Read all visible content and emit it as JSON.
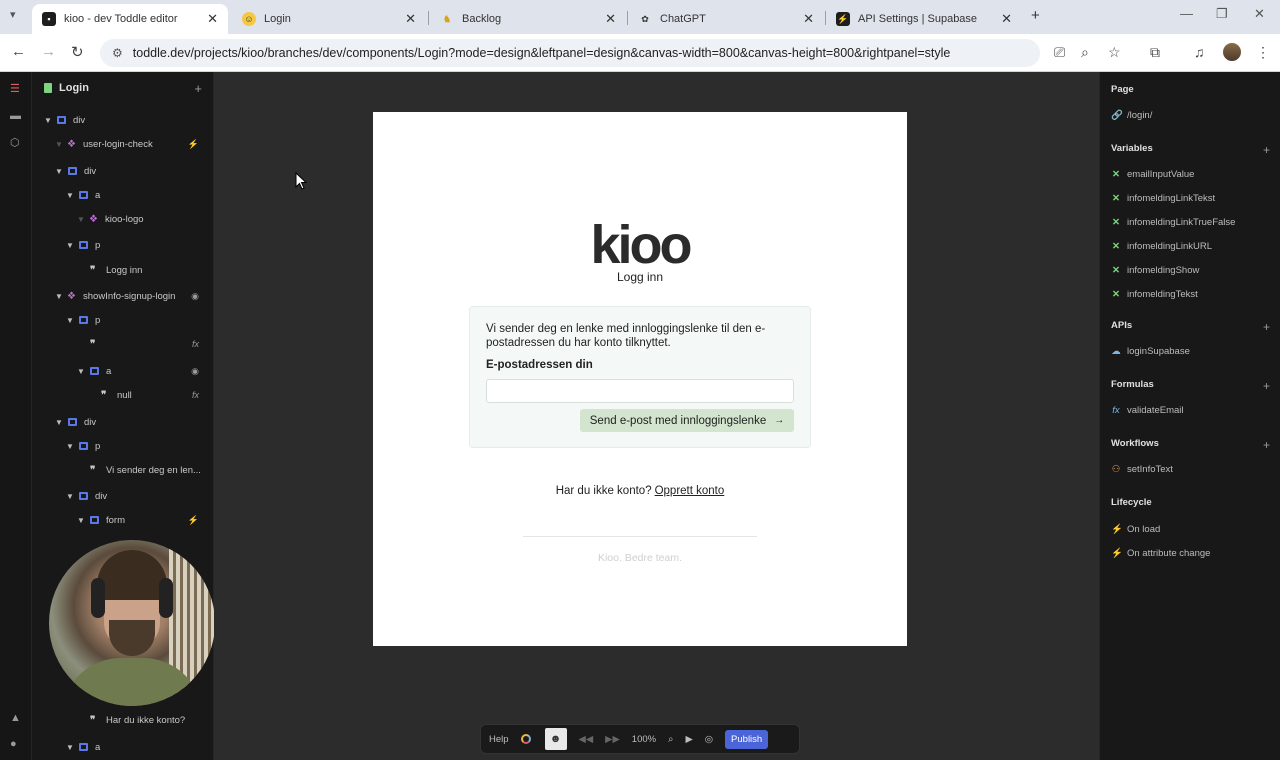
{
  "browser": {
    "tabs": [
      {
        "title": "kioo - dev Toddle editor",
        "icon": "toddle-icon",
        "active": true
      },
      {
        "title": "Login",
        "icon": "smiley-icon",
        "active": false
      },
      {
        "title": "Backlog",
        "icon": "backlog-icon",
        "active": false
      },
      {
        "title": "ChatGPT",
        "icon": "chatgpt-icon",
        "active": false
      },
      {
        "title": "API Settings | Supabase",
        "icon": "supabase-icon",
        "active": false
      }
    ],
    "url": "toddle.dev/projects/kioo/branches/dev/components/Login?mode=design&leftpanel=design&canvas-width=800&canvas-height=800&rightpanel=style"
  },
  "left_panel": {
    "title": "Login",
    "tree": [
      {
        "label": "div",
        "type": "element"
      },
      {
        "label": "user-login-check",
        "type": "component"
      },
      {
        "label": "div",
        "type": "element"
      },
      {
        "label": "a",
        "type": "element"
      },
      {
        "label": "kioo-logo",
        "type": "component"
      },
      {
        "label": "p",
        "type": "element"
      },
      {
        "label": "Logg inn",
        "type": "text"
      },
      {
        "label": "showInfo-signup-login",
        "type": "component"
      },
      {
        "label": "p",
        "type": "element"
      },
      {
        "label": "",
        "type": "text"
      },
      {
        "label": "a",
        "type": "element"
      },
      {
        "label": "null",
        "type": "text"
      },
      {
        "label": "div",
        "type": "element"
      },
      {
        "label": "p",
        "type": "element"
      },
      {
        "label": "Vi sender deg en len...",
        "type": "text"
      },
      {
        "label": "div",
        "type": "element"
      },
      {
        "label": "form",
        "type": "element"
      },
      {
        "label": "Har du ikke konto?",
        "type": "text"
      },
      {
        "label": "a",
        "type": "element"
      }
    ]
  },
  "canvas": {
    "logo": "kioo",
    "subtitle": "Logg inn",
    "info_text": "Vi sender deg en lenke med innloggingslenke til den e-postadressen du har konto tilknyttet.",
    "email_label": "E-postadressen din",
    "email_value": "",
    "send_button": "Send e-post med innloggingslenke",
    "signup_text": "Har du ikke konto?",
    "signup_link": "Opprett konto",
    "tagline": "Kioo. Bedre team."
  },
  "toolbar": {
    "help": "Help",
    "zoom": "100%",
    "publish": "Publish"
  },
  "right_panel": {
    "page_title": "Page",
    "page_path": "/login/",
    "variables_title": "Variables",
    "variables": [
      "emailInputValue",
      "infomeldingLinkTekst",
      "infomeldingLinkTrueFalse",
      "infomeldingLinkURL",
      "infomeldingShow",
      "infomeldingTekst"
    ],
    "apis_title": "APIs",
    "apis": [
      "loginSupabase"
    ],
    "formulas_title": "Formulas",
    "formulas": [
      "validateEmail"
    ],
    "workflows_title": "Workflows",
    "workflows": [
      "setInfoText"
    ],
    "lifecycle_title": "Lifecycle",
    "lifecycle": [
      "On load",
      "On attribute change"
    ]
  },
  "colors": {
    "accent": "#4b65d9",
    "element_icon": "#5b78e6",
    "component_icon": "#c06bd8",
    "variable_icon": "#7ed47e",
    "send_button_bg": "#d3e4cf"
  }
}
